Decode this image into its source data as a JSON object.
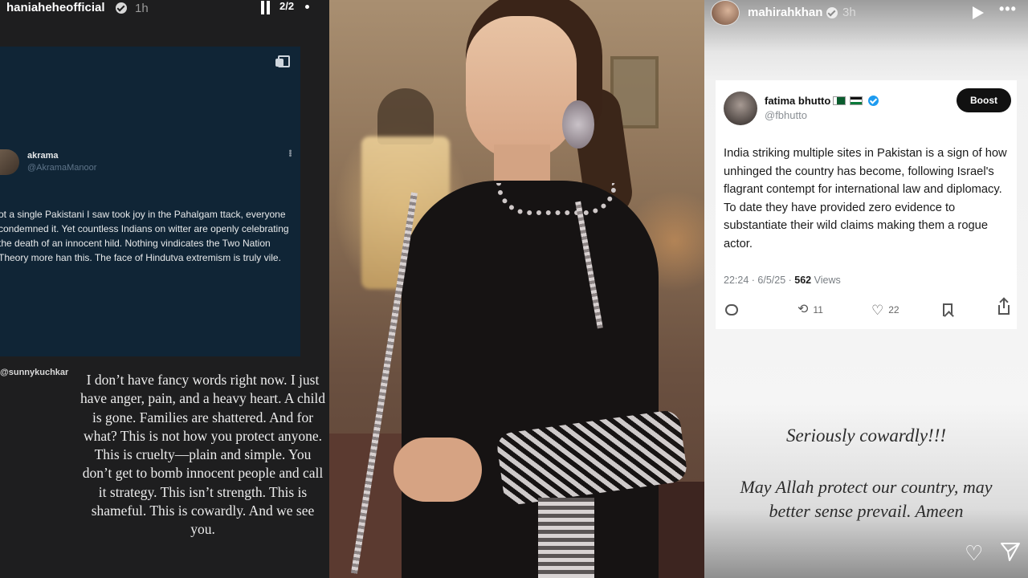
{
  "left_story": {
    "username": "haniaheheofficial",
    "time": "1h",
    "counter": "2/2",
    "tweet": {
      "name": "akrama",
      "handle": "@AkramaManoor",
      "text": "ot a single Pakistani I saw took joy in the Pahalgam ttack, everyone condemned it. Yet countless Indians on witter are openly celebrating the death of an innocent hild. Nothing vindicates the Two Nation Theory more han this. The face of Hindutva extremism is truly vile."
    },
    "mention": "@sunnykuchkar",
    "message": "I don’t have fancy words right now. I just have anger, pain, and a heavy heart. A child is gone. Families are shattered. And for what? This is not how you protect anyone. This is cruelty—plain and simple. You don’t get to bomb innocent people and call it strategy. This isn’t strength. This is shameful. This is cowardly. And we see you."
  },
  "right_story": {
    "username": "mahirahkhan",
    "time": "3h",
    "more": "•••",
    "tweet": {
      "name": "fatima bhutto",
      "handle": "@fbhutto",
      "boost_label": "Boost",
      "text": "India striking multiple sites in Pakistan is a sign of how unhinged the country has become, following Israel's flagrant contempt for international law and diplomacy. To date they have provided zero evidence to substantiate their wild claims making them a rogue actor.",
      "time_date": "22:24 · 6/5/25 · ",
      "views_count": "562",
      "views_label": " Views",
      "retweets": "11",
      "likes": "22"
    },
    "caption1": "Seriously cowardly!!!",
    "caption2": "May Allah protect our country, may better sense prevail. Ameen"
  },
  "icons": {
    "verified": "verified-badge-icon",
    "pause": "pause-icon",
    "copy": "copy-icon",
    "play": "play-icon",
    "reply": "reply-icon",
    "retweet": "retweet-icon",
    "like": "heart-icon",
    "bookmark": "bookmark-icon",
    "share": "share-icon",
    "send": "send-icon"
  },
  "colors": {
    "left_bg": "#1e1e1f",
    "dark_tweet_bg": "#102536",
    "twitter_blue": "#1d9bf0",
    "boost_bg": "#111111"
  }
}
